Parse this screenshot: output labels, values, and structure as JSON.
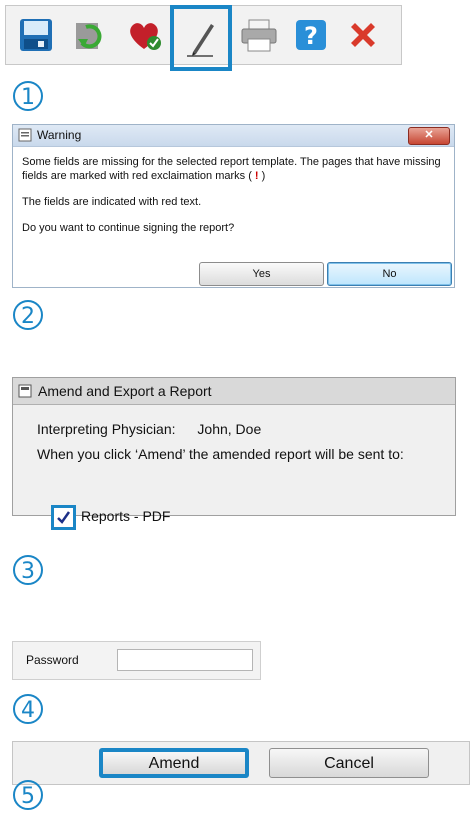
{
  "steps": [
    "1",
    "2",
    "3",
    "4",
    "5"
  ],
  "toolbar": {
    "icons": [
      "save-icon",
      "refresh-icon",
      "heart-icon",
      "pen-sign-icon",
      "print-icon",
      "help-icon",
      "close-icon"
    ],
    "highlighted": "pen-sign-icon",
    "help_glyph": "?"
  },
  "warning": {
    "title": "Warning",
    "close_glyph": "✕",
    "line1": "Some fields are missing for the selected report template. The pages that have missing fields are marked with red exclaimation marks (",
    "mark": "!",
    "line1_end": ")",
    "line2": "The fields are indicated with red text.",
    "line3": "Do you want to continue signing the report?",
    "yes": "Yes",
    "no": "No"
  },
  "amend": {
    "title": "Amend and Export a Report",
    "physician_label": "Interpreting Physician:",
    "physician_name": "John, Doe",
    "info": "When you click ‘Amend’ the amended report will be sent to:",
    "option": "Reports - PDF",
    "option_checked": true
  },
  "password": {
    "label": "Password",
    "value": ""
  },
  "actions": {
    "amend": "Amend",
    "cancel": "Cancel"
  },
  "colors": {
    "highlight": "#1a86c6",
    "error": "#c00000"
  }
}
